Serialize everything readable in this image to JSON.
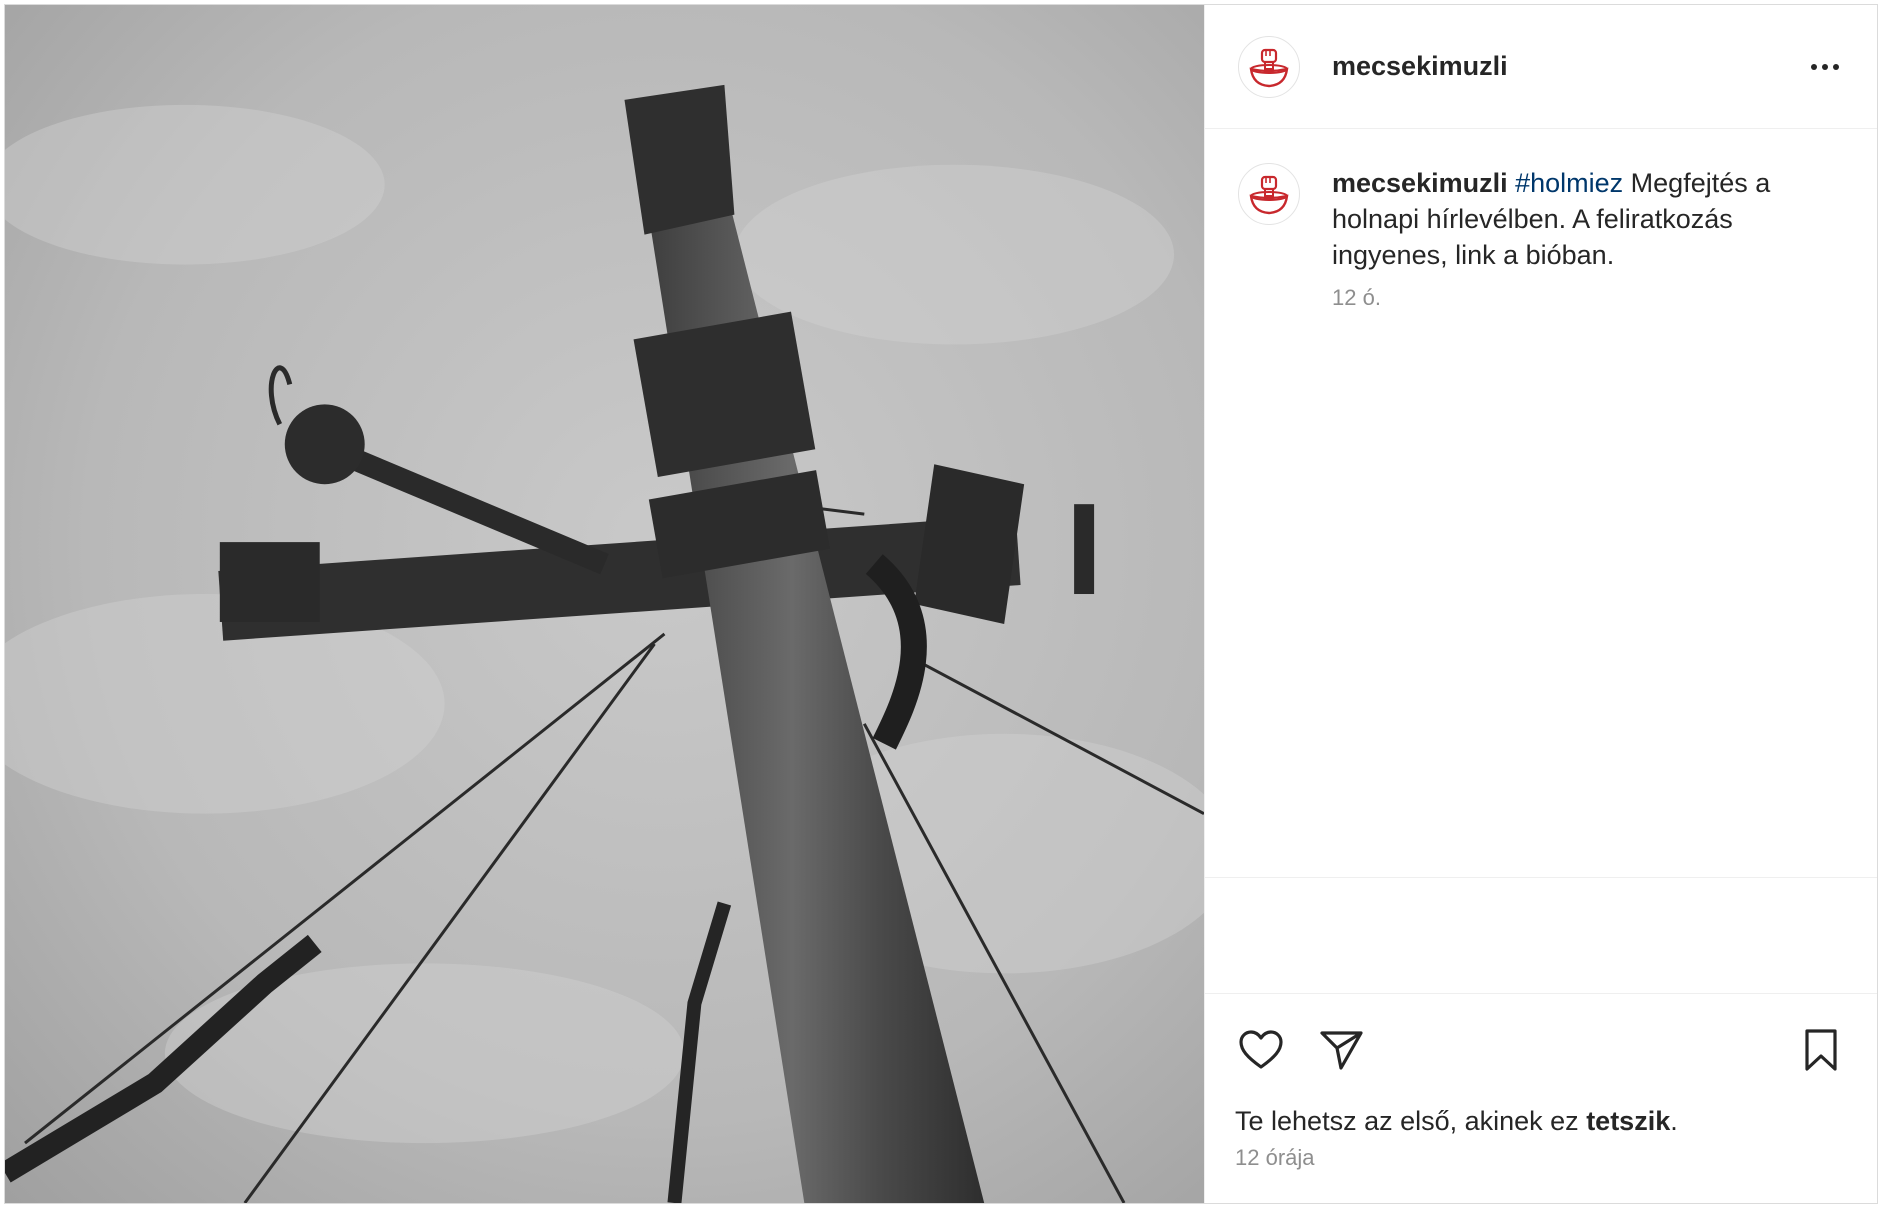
{
  "header": {
    "username": "mecsekimuzli",
    "more_icon": "ellipsis-icon"
  },
  "caption": {
    "username": "mecsekimuzli",
    "hashtag": "#holmiez",
    "text": " Megfejtés a holnapi hírlevélben. A feliratkozás ingyenes, link a bióban.",
    "time": "12 ó."
  },
  "actions": {
    "like_icon": "heart-icon",
    "share_icon": "paper-plane-icon",
    "save_icon": "bookmark-icon"
  },
  "likes": {
    "prefix": "Te lehetsz az első, akinek ez ",
    "link": "tetszik",
    "suffix": "."
  },
  "post_date": "12 órája",
  "colors": {
    "hashtag": "#00376b",
    "avatar_red": "#c8282d",
    "secondary_text": "#8e8e8e"
  }
}
